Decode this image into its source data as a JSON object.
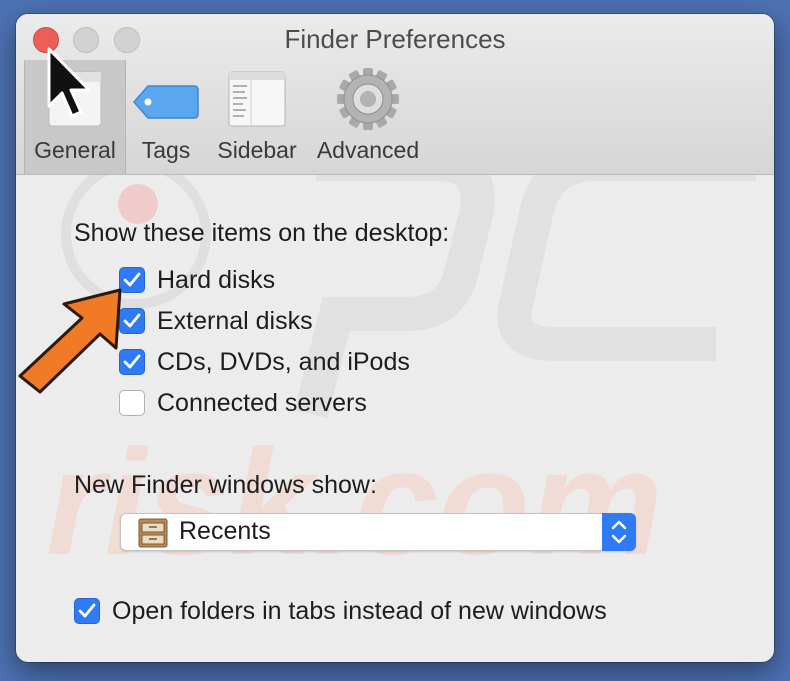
{
  "window": {
    "title": "Finder Preferences"
  },
  "toolbar": {
    "tabs": [
      {
        "label": "General",
        "icon": "general-icon",
        "selected": true
      },
      {
        "label": "Tags",
        "icon": "tag-icon",
        "selected": false
      },
      {
        "label": "Sidebar",
        "icon": "sidebar-icon",
        "selected": false
      },
      {
        "label": "Advanced",
        "icon": "gear-icon",
        "selected": false
      }
    ]
  },
  "desktop_items": {
    "heading": "Show these items on the desktop:",
    "items": [
      {
        "label": "Hard disks",
        "checked": true
      },
      {
        "label": "External disks",
        "checked": true
      },
      {
        "label": "CDs, DVDs, and iPods",
        "checked": true
      },
      {
        "label": "Connected servers",
        "checked": false
      }
    ]
  },
  "new_window": {
    "heading": "New Finder windows show:",
    "selected": "Recents",
    "icon": "recents-cabinet-icon"
  },
  "open_in_tabs": {
    "label": "Open folders in tabs instead of new windows",
    "checked": true
  },
  "colors": {
    "accent": "#2f7bf6",
    "close": "#ec5f57",
    "annotation_arrow": "#f07a26",
    "desktop": "#4d72b4"
  }
}
